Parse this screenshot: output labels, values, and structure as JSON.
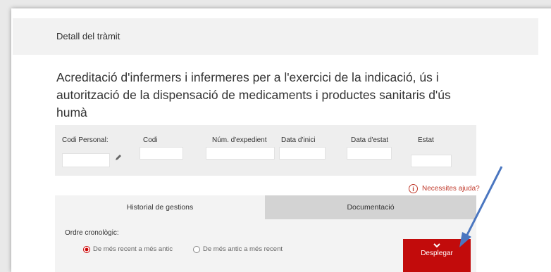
{
  "header": {
    "title": "Detall del tràmit"
  },
  "procedure": {
    "title": "Acreditació d'infermers i infermeres per a l'exercici de la indicació, ús i autorització de la dispensació de medicaments i productes sanitaris d'ús humà"
  },
  "fields": {
    "personal_code": "Codi Personal:",
    "code": "Codi",
    "file_number": "Núm. d'expedient",
    "start_date": "Data d'inici",
    "status_date": "Data d'estat",
    "status": "Estat"
  },
  "help": {
    "label": "Necessites ajuda?",
    "icon": "info-icon"
  },
  "tabs": [
    {
      "label": "Historial de gestions",
      "active": true
    },
    {
      "label": "Documentació",
      "active": false
    }
  ],
  "history": {
    "order_label": "Ordre cronològic:",
    "options": [
      {
        "label": "De més recent a més antic",
        "selected": true
      },
      {
        "label": "De més antic a més recent",
        "selected": false
      }
    ],
    "expand_button": "Desplegar"
  },
  "colors": {
    "accent": "#c20b0b",
    "annotation_arrow": "#4a76c0"
  }
}
